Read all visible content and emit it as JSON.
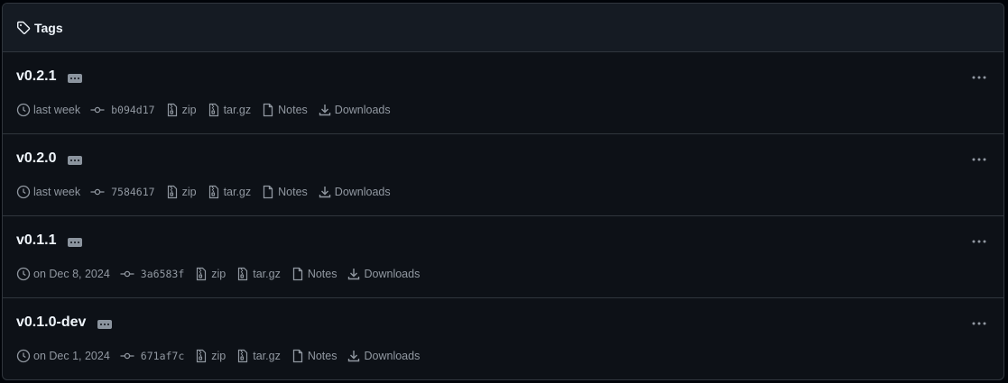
{
  "header": {
    "title": "Tags",
    "icon": "tag-icon"
  },
  "colors": {
    "bg": "#0d1117",
    "header_bg": "#151b23",
    "border": "#30363d",
    "muted": "#9198a1",
    "text": "#f0f6fc"
  },
  "tags": [
    {
      "name": "v0.2.1",
      "date": "last week",
      "commit": "b094d17",
      "zip": "zip",
      "targz": "tar.gz",
      "notes": "Notes",
      "downloads": "Downloads"
    },
    {
      "name": "v0.2.0",
      "date": "last week",
      "commit": "7584617",
      "zip": "zip",
      "targz": "tar.gz",
      "notes": "Notes",
      "downloads": "Downloads"
    },
    {
      "name": "v0.1.1",
      "date": "on Dec 8, 2024",
      "commit": "3a6583f",
      "zip": "zip",
      "targz": "tar.gz",
      "notes": "Notes",
      "downloads": "Downloads"
    },
    {
      "name": "v0.1.0-dev",
      "date": "on Dec 1, 2024",
      "commit": "671af7c",
      "zip": "zip",
      "targz": "tar.gz",
      "notes": "Notes",
      "downloads": "Downloads"
    }
  ]
}
